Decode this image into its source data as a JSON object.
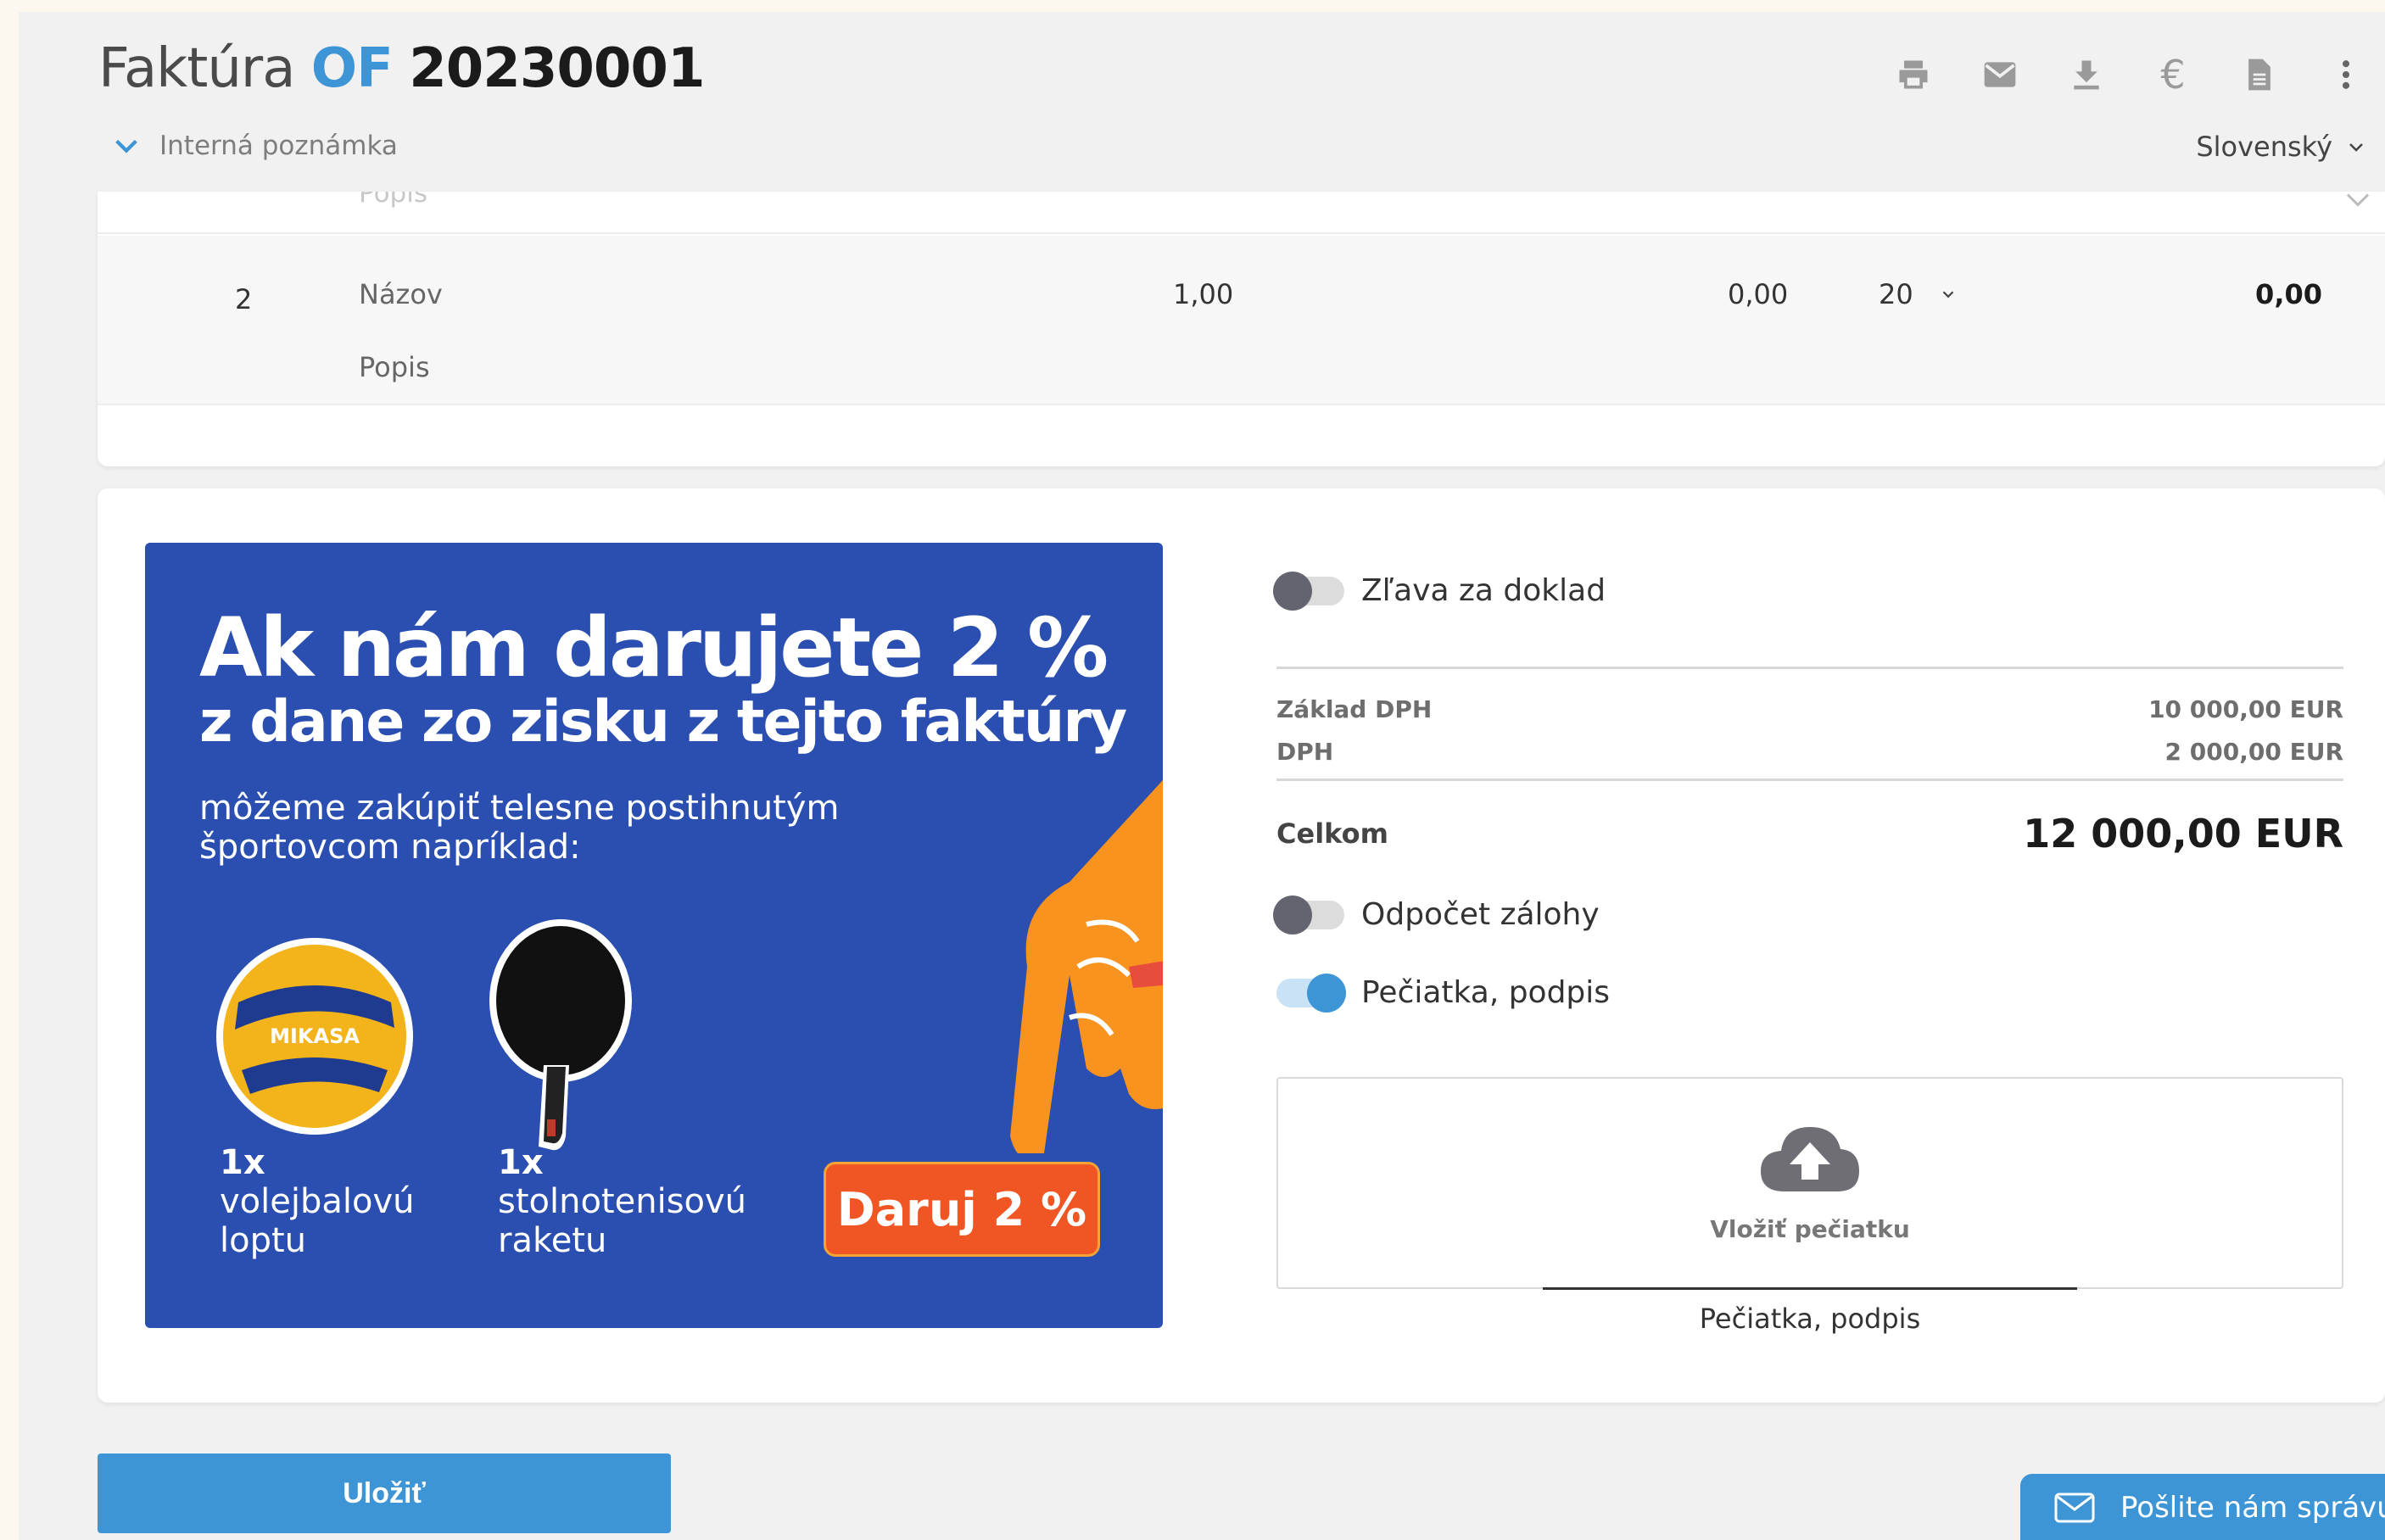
{
  "header": {
    "title_prefix": "Faktúra",
    "title_series": "OF",
    "title_number": "20230001",
    "internal_note": "Interná poznámka",
    "language": "Slovenský"
  },
  "items": {
    "prev_row_ghost": "Popis",
    "row": {
      "number": "2",
      "name": "Názov",
      "description": "Popis",
      "quantity": "1,00",
      "unit_price": "0,00",
      "vat_rate": "20",
      "total": "0,00"
    }
  },
  "banner": {
    "headline": "Ak nám darujete 2 %",
    "subheadline": "z dane zo zisku z tejto faktúry",
    "text": "môžeme zakúpiť telesne postihnutým športovcom napríklad:",
    "ball_brand": "MIKASA",
    "item1_qty": "1x",
    "item1_name": "volejbalovú loptu",
    "item2_qty": "1x",
    "item2_name": "stolnotenisovú raketu",
    "cta": "Daruj 2 %"
  },
  "summary": {
    "discount_label": "Zľava za doklad",
    "base_label": "Základ DPH",
    "base_value": "10 000,00 EUR",
    "vat_label": "DPH",
    "vat_value": "2 000,00 EUR",
    "total_label": "Celkom",
    "total_value": "12 000,00 EUR",
    "advance_label": "Odpočet zálohy",
    "stamp_label": "Pečiatka, podpis",
    "upload_label": "Vložiť pečiatku",
    "signature_caption": "Pečiatka, podpis",
    "discount_on": false,
    "advance_on": false,
    "stamp_on": true
  },
  "actions": {
    "save": "Uložiť",
    "chat": "Pošlite nám správu"
  },
  "colors": {
    "accent": "#3d95d6",
    "banner_bg": "#2a4fb1",
    "cta_bg": "#ef5623"
  }
}
